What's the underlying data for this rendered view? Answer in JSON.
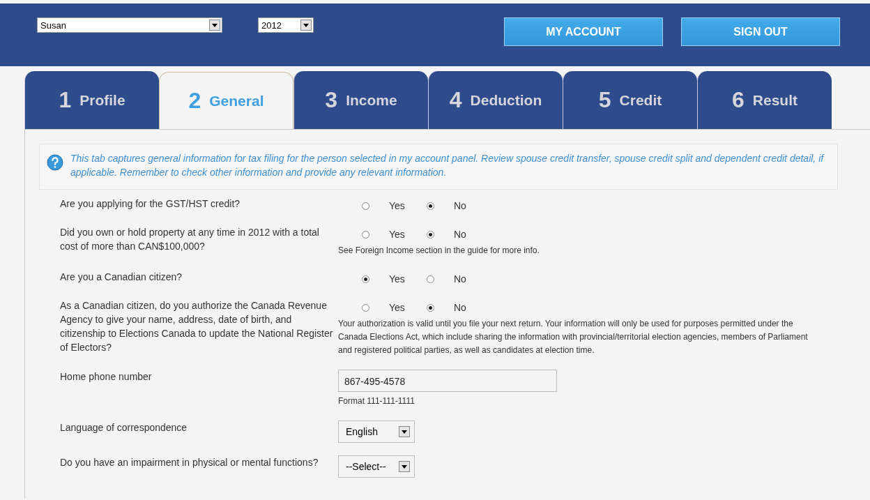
{
  "header": {
    "person_select": {
      "value": "Susan"
    },
    "year_select": {
      "value": "2012"
    },
    "buttons": [
      "MY ACCOUNT",
      "SIGN OUT"
    ]
  },
  "tabs": [
    {
      "number": "1",
      "label": "Profile",
      "selected": false
    },
    {
      "number": "2",
      "label": "General",
      "selected": true
    },
    {
      "number": "3",
      "label": "Income",
      "selected": false
    },
    {
      "number": "4",
      "label": "Deduction",
      "selected": false
    },
    {
      "number": "5",
      "label": "Credit",
      "selected": false
    },
    {
      "number": "6",
      "label": "Result",
      "selected": false
    }
  ],
  "info": "This tab captures general information for tax filing for the person selected in my account panel. Review spouse credit transfer, spouse credit split and dependent credit detail, if applicable. Remember to check other information and provide any relevant information.",
  "questions": [
    {
      "kind": "radio",
      "question": "Are you applying for the GST/HST credit?",
      "options": [
        {
          "label": "Yes",
          "selected": false
        },
        {
          "label": "No",
          "selected": true
        }
      ]
    },
    {
      "kind": "radio",
      "question": "Did you own or hold property at any time in 2012 with a total cost of more than CAN$100,000?",
      "options": [
        {
          "label": "Yes",
          "selected": false
        },
        {
          "label": "No",
          "selected": true
        }
      ],
      "note": "See Foreign Income section in the guide for more info."
    },
    {
      "kind": "radio",
      "question": "Are you a Canadian citizen?",
      "options": [
        {
          "label": "Yes",
          "selected": true
        },
        {
          "label": "No",
          "selected": false
        }
      ]
    },
    {
      "kind": "radio",
      "question": "As a Canadian citizen, do you authorize the Canada Revenue Agency to give your name, address, date of birth, and citizenship to Elections Canada to update the National Register of Electors?",
      "options": [
        {
          "label": "Yes",
          "selected": false
        },
        {
          "label": "No",
          "selected": true
        }
      ],
      "note": "Your authorization is valid until you file your next return. Your information will only be used for purposes permitted under the Canada Elections Act, which include sharing the information with provincial/territorial election agencies, members of Parliament and registered political parties, as well as candidates at election time."
    },
    {
      "kind": "text",
      "question": "Home phone number",
      "value": "867-495-4578",
      "note": "Format 111-111-1111"
    },
    {
      "kind": "select",
      "question": "Language of correspondence",
      "value": "English"
    },
    {
      "kind": "select",
      "question": "Do you have an impairment in physical or mental functions?",
      "value": "--Select--"
    }
  ]
}
